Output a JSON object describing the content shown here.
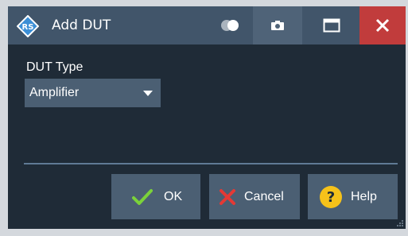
{
  "window": {
    "title": "Add DUT",
    "colors": {
      "titlebar": "#41556a",
      "panel": "#1f2b37",
      "control": "#4b5f73",
      "close": "#c13c3c",
      "ok_check": "#7bd23a",
      "cancel_x": "#e53935",
      "help": "#f6c21a"
    }
  },
  "titlebar": {
    "icons": [
      "app-logo-icon",
      "toggle-icon",
      "camera-icon",
      "maximize-icon",
      "close-icon"
    ]
  },
  "form": {
    "dut_type_label": "DUT Type",
    "dut_type_value": "Amplifier"
  },
  "buttons": {
    "ok_label": "OK",
    "cancel_label": "Cancel",
    "help_label": "Help"
  }
}
